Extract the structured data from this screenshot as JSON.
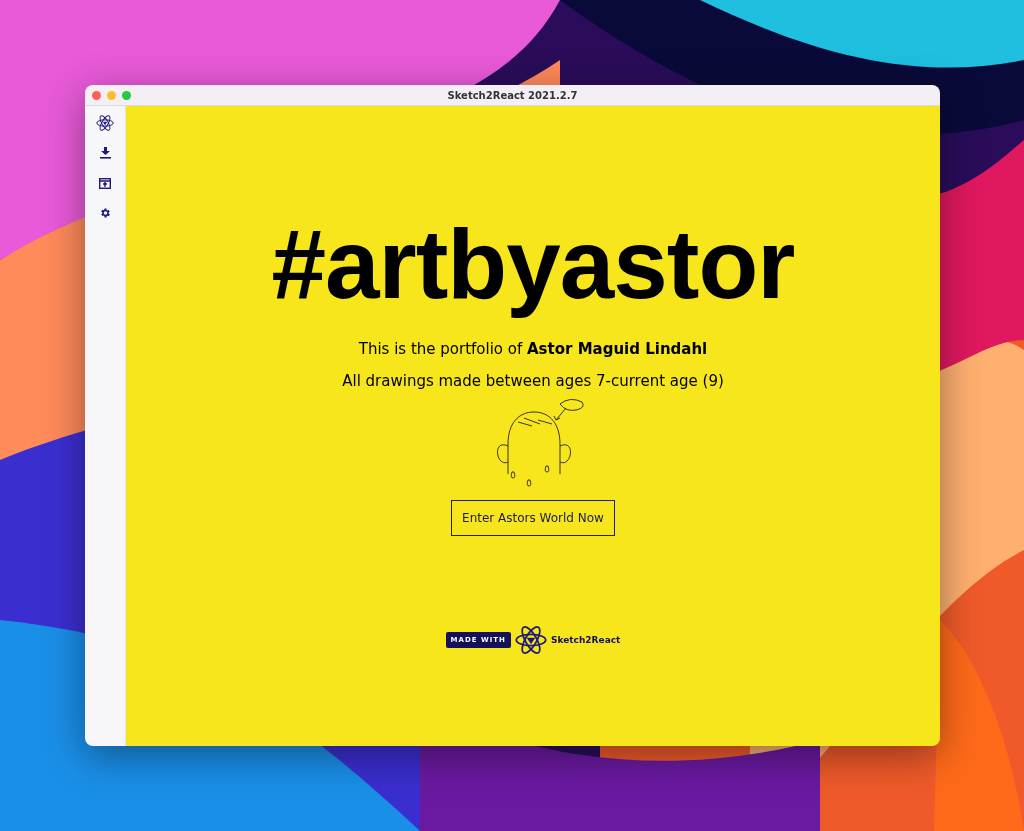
{
  "window": {
    "title": "Sketch2React 2021.2.7"
  },
  "sidebar": {
    "items": [
      {
        "kind": "logo"
      },
      {
        "kind": "download"
      },
      {
        "kind": "export"
      },
      {
        "kind": "settings"
      }
    ]
  },
  "hero": {
    "title": "#artbyastor",
    "intro": "This is the portfolio of **Astor Maguid Lindahl**",
    "subtitle": "All drawings made between ages 7-current age (9)",
    "button": "Enter Astors World Now"
  },
  "badge": {
    "label": "MADE WITH",
    "brand": "Sketch2React"
  }
}
